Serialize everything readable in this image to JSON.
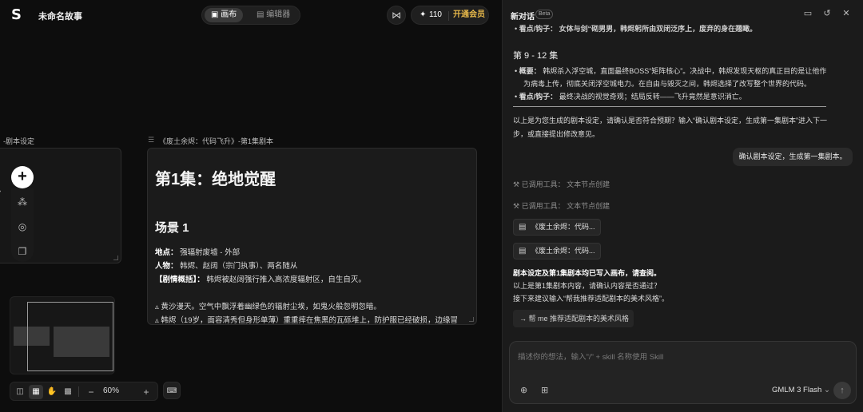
{
  "header": {
    "project_title": "未命名故事",
    "tabs": [
      {
        "label": "画布",
        "icon": "canvas-icon"
      },
      {
        "label": "编辑器",
        "icon": "film-icon"
      }
    ],
    "credits": "110",
    "upgrade_label": "开通会员"
  },
  "canvas": {
    "node1_label": "-剧本设定",
    "node2_label": "《废土余烬：代码飞升》-第1集剧本",
    "node2": {
      "title": "第1集：绝地觉醒",
      "scene": "场景 1",
      "place_label": "地点：",
      "place": "强辐射废墟 - 外部",
      "people_label": "人物：",
      "people": "韩烬、赵阔（宗门执事）、两名随从",
      "plot_label": "【剧情概括】：",
      "plot": "韩烬被赵阔强行推入高浓度辐射区，自生自灭。",
      "line1": "▵ 黄沙漫天。空气中飘浮着幽绿色的辐射尘埃，如鬼火般忽明忽暗。",
      "line2": "▵ 韩烬（19岁，面容清秀但身形单薄）重重摔在焦黑的瓦砾堆上，防护服已经破损，边缘冒"
    },
    "zoom": "60%"
  },
  "chat": {
    "title": "新对话",
    "beta": "Beta",
    "top_cut": "看点/钩子：  女体与剑“砌男男，韩烬躬所由双闭泛序上，废弃的身在翘瞰。",
    "section_heading": "第 9 - 12 集",
    "bullets": [
      {
        "label": "概要：",
        "text": "韩烬杀入浮空城，直面最终BOSS“矩阵核心”。决战中，韩烬发现天枢的真正目的是让他作",
        "cont": "为病毒上传，彻底关闭浮空城电力。在自由与毁灭之间，韩烬选择了改写整个世界的代码。"
      },
      {
        "label": "看点/钩子：",
        "text": "最终决战的视觉奇观；结局反转——飞升竟然是意识消亡。"
      }
    ],
    "confirm_text_1": "以上是为您生成的剧本设定，请确认是否符合预期？输入“确认剧本设定，生成第一集剧本”进入下一",
    "confirm_text_2": "步，或直接提出修改意见。",
    "user_message": "确认剧本设定，生成第一集剧本。",
    "tool_calls": [
      "已调用工具：  文本节点创建",
      "已调用工具：  文本节点创建"
    ],
    "chips": [
      "《废土余烬：代码...",
      "《废土余烬：代码..."
    ],
    "result_bold": "剧本设定及第1集剧本均已写入画布，请查阅。",
    "result_line2": "以上是第1集剧本内容，请确认内容是否通过？",
    "result_line3": "接下来建议输入“帮我推荐适配剧本的美术风格”。",
    "suggestion": "帮 me 推荐适配剧本的美术风格",
    "input_placeholder": "描述你的想法，输入\"/\" + skill 名称使用 Skill",
    "model": "GMLM 3 Flash"
  }
}
